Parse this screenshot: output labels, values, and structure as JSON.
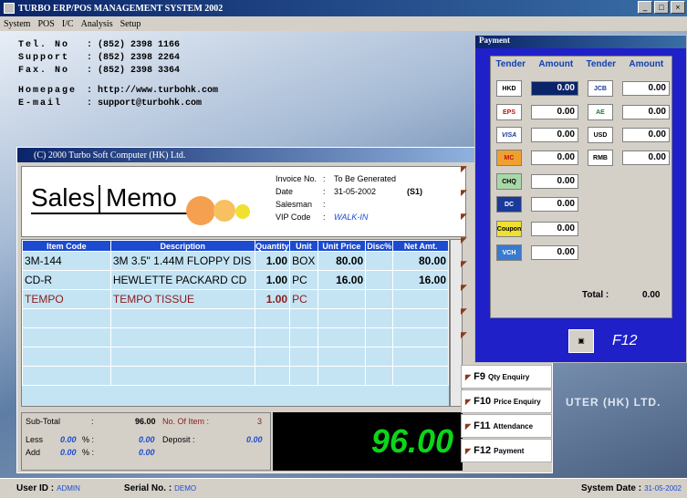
{
  "window": {
    "title": "TURBO ERP/POS MANAGEMENT SYSTEM 2002"
  },
  "menu": [
    "System",
    "POS",
    "I/C",
    "Analysis",
    "Setup"
  ],
  "contact": {
    "tel_label": "Tel. No",
    "tel": ":  (852) 2398 1166",
    "support_label": "Support",
    "support": ":  (852) 2398 2264",
    "fax_label": "Fax. No",
    "fax": ":  (852) 2398 3364",
    "homepage_label": "Homepage",
    "homepage": ":  http://www.turbohk.com",
    "email_label": "E-mail",
    "email": ":  support@turbohk.com"
  },
  "bg_brand": "UTER (HK) LTD.",
  "sales": {
    "title": "(C) 2000 Turbo Soft Computer (HK) Ltd.",
    "logo_left": "Sales",
    "logo_right": "Memo",
    "invoice": {
      "invoice_label": "Invoice No.",
      "invoice_value": "To Be Generated",
      "date_label": "Date",
      "date_value": "31-05-2002",
      "station": "(S1)",
      "salesman_label": "Salesman",
      "salesman_value": "",
      "vip_label": "VIP Code",
      "vip_value": "WALK-IN"
    },
    "columns": [
      "Item Code",
      "Description",
      "Quantity",
      "Unit",
      "Unit Price",
      "Disc%",
      "Net Amt."
    ],
    "rows": [
      {
        "code": "3M-144",
        "desc": "3M 3.5\" 1.44M FLOPPY DIS",
        "qty": "1.00",
        "unit": "BOX",
        "price": "80.00",
        "disc": "",
        "net": "80.00"
      },
      {
        "code": "CD-R",
        "desc": "HEWLETTE PACKARD CD",
        "qty": "1.00",
        "unit": "PC",
        "price": "16.00",
        "disc": "",
        "net": "16.00"
      },
      {
        "code": "TEMPO",
        "desc": "TEMPO TISSUE",
        "qty": "1.00",
        "unit": "PC",
        "price": "",
        "disc": "",
        "net": ""
      }
    ],
    "totals": {
      "subtotal_label": "Sub-Total",
      "subtotal": "96.00",
      "items_label": "No. Of Item :",
      "items": "3",
      "less_label": "Less",
      "less_pct": "0.00",
      "less_amt": "0.00",
      "add_label": "Add",
      "add_pct": "0.00",
      "add_amt": "0.00",
      "deposit_label": "Deposit :",
      "deposit": "0.00",
      "big_total": "96.00"
    }
  },
  "fkeys": [
    {
      "key": "F9",
      "label": "Qty Enquiry"
    },
    {
      "key": "F10",
      "label": "Price Enquiry"
    },
    {
      "key": "F11",
      "label": "Attendance"
    },
    {
      "key": "F12",
      "label": "Payment"
    }
  ],
  "payment": {
    "title": "Payment",
    "hdr_tender": "Tender",
    "hdr_amount": "Amount",
    "left": [
      {
        "icon": "HKD",
        "amount": "0.00"
      },
      {
        "icon": "EPS",
        "amount": "0.00"
      },
      {
        "icon": "VISA",
        "amount": "0.00"
      },
      {
        "icon": "MC",
        "amount": "0.00"
      },
      {
        "icon": "CHQ",
        "amount": "0.00"
      },
      {
        "icon": "DC",
        "amount": "0.00"
      },
      {
        "icon": "Coupon",
        "amount": "0.00"
      },
      {
        "icon": "VCH",
        "amount": "0.00"
      }
    ],
    "right": [
      {
        "icon": "JCB",
        "amount": "0.00"
      },
      {
        "icon": "AE",
        "amount": "0.00"
      },
      {
        "icon": "USD",
        "amount": "0.00"
      },
      {
        "icon": "RMB",
        "amount": "0.00"
      }
    ],
    "total_label": "Total :",
    "total": "0.00",
    "f12": "F12"
  },
  "status": {
    "user_label": "User ID :",
    "user": "ADMIN",
    "serial_label": "Serial No. :",
    "serial": "DEMO",
    "date_label": "System Date :",
    "date": "31-05-2002"
  }
}
